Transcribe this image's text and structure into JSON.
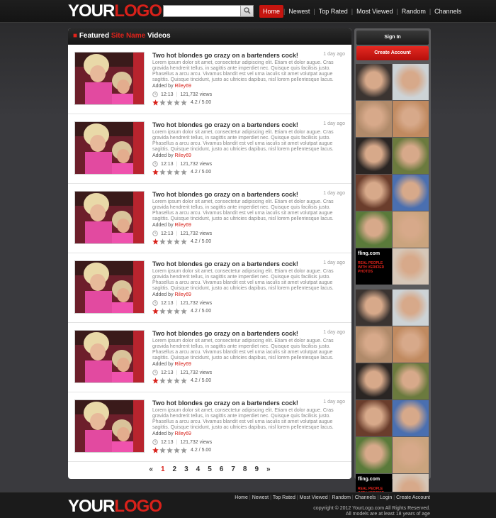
{
  "header": {
    "logo_part1": "YOUR",
    "logo_part2": "LOGO",
    "search_placeholder": "",
    "nav": [
      {
        "label": "Home",
        "active": true
      },
      {
        "label": "Newest"
      },
      {
        "label": "Top Rated"
      },
      {
        "label": "Most Viewed"
      },
      {
        "label": "Random"
      },
      {
        "label": "Channels"
      }
    ]
  },
  "content": {
    "heading_prefix": "Featured",
    "heading_highlight": "Site Name",
    "heading_suffix": "Videos",
    "videos": [
      {
        "title": "Two hot blondes go crazy on a bartenders cock!",
        "ago": "1 day ago",
        "description": "Lorem ipsum dolor sit amet, consectetur adipiscing elit. Etiam et dolor augue. Cras gravida hendrerit tellus, in sagittis ante imperdiet nec. Quisque quis facilisis justo. Phasellus a arcu arcu. Vivamus blandit est vel urna iaculis sit amet volutpat augue sagittis. Quisque tincidunt, justo ac ultricies dapibus, nisl lorem pellentesque lacus.",
        "added_by_label": "Added by",
        "user": "Riley69",
        "duration": "12:13",
        "views": "121,732 views",
        "rating": "4.2 / 5.00"
      },
      {
        "title": "Two hot blondes go crazy on a bartenders cock!",
        "ago": "1 day ago",
        "description": "Lorem ipsum dolor sit amet, consectetur adipiscing elit. Etiam et dolor augue. Cras gravida hendrerit tellus, in sagittis ante imperdiet nec. Quisque quis facilisis justo. Phasellus a arcu arcu. Vivamus blandit est vel urna iaculis sit amet volutpat augue sagittis. Quisque tincidunt, justo ac ultricies dapibus, nisl lorem pellentesque lacus.",
        "added_by_label": "Added by",
        "user": "Riley69",
        "duration": "12:13",
        "views": "121,732 views",
        "rating": "4.2 / 5.00"
      },
      {
        "title": "Two hot blondes go crazy on a bartenders cock!",
        "ago": "1 day ago",
        "description": "Lorem ipsum dolor sit amet, consectetur adipiscing elit. Etiam et dolor augue. Cras gravida hendrerit tellus, in sagittis ante imperdiet nec. Quisque quis facilisis justo. Phasellus a arcu arcu. Vivamus blandit est vel urna iaculis sit amet volutpat augue sagittis. Quisque tincidunt, justo ac ultricies dapibus, nisl lorem pellentesque lacus.",
        "added_by_label": "Added by",
        "user": "Riley69",
        "duration": "12:13",
        "views": "121,732 views",
        "rating": "4.2 / 5.00"
      },
      {
        "title": "Two hot blondes go crazy on a bartenders cock!",
        "ago": "1 day ago",
        "description": "Lorem ipsum dolor sit amet, consectetur adipiscing elit. Etiam et dolor augue. Cras gravida hendrerit tellus, in sagittis ante imperdiet nec. Quisque quis facilisis justo. Phasellus a arcu arcu. Vivamus blandit est vel urna iaculis sit amet volutpat augue sagittis. Quisque tincidunt, justo ac ultricies dapibus, nisl lorem pellentesque lacus.",
        "added_by_label": "Added by",
        "user": "Riley69",
        "duration": "12:13",
        "views": "121,732 views",
        "rating": "4.2 / 5.00"
      },
      {
        "title": "Two hot blondes go crazy on a bartenders cock!",
        "ago": "1 day ago",
        "description": "Lorem ipsum dolor sit amet, consectetur adipiscing elit. Etiam et dolor augue. Cras gravida hendrerit tellus, in sagittis ante imperdiet nec. Quisque quis facilisis justo. Phasellus a arcu arcu. Vivamus blandit est vel urna iaculis sit amet volutpat augue sagittis. Quisque tincidunt, justo ac ultricies dapibus, nisl lorem pellentesque lacus.",
        "added_by_label": "Added by",
        "user": "Riley69",
        "duration": "12:13",
        "views": "121,732 views",
        "rating": "4.2 / 5.00"
      },
      {
        "title": "Two hot blondes go crazy on a bartenders cock!",
        "ago": "1 day ago",
        "description": "Lorem ipsum dolor sit amet, consectetur adipiscing elit. Etiam et dolor augue. Cras gravida hendrerit tellus, in sagittis ante imperdiet nec. Quisque quis facilisis justo. Phasellus a arcu arcu. Vivamus blandit est vel urna iaculis sit amet volutpat augue sagittis. Quisque tincidunt, justo ac ultricies dapibus, nisl lorem pellentesque lacus.",
        "added_by_label": "Added by",
        "user": "Riley69",
        "duration": "12:13",
        "views": "121,732 views",
        "rating": "4.2 / 5.00"
      }
    ],
    "stars_filled": 1,
    "stars_total": 5
  },
  "pager": [
    "«",
    "1",
    "2",
    "3",
    "4",
    "5",
    "6",
    "7",
    "8",
    "9",
    "»"
  ],
  "pager_active": "1",
  "sidebar": {
    "signin": "Sign In",
    "create": "Create Account",
    "ad_brand": "fling.com",
    "ad_tagline": "REAL PEOPLE WITH VERIFIED PHOTOS"
  },
  "footer": {
    "nav": [
      "Home",
      "Newest",
      "Top Rated",
      "Most Viewed",
      "Random",
      "Channels",
      "Login",
      "Create Account"
    ],
    "copyright": "copyright © 2012 YourLogo.com All Rights Reserved.",
    "age_notice": "All models are at least 18 years of age"
  },
  "colors": {
    "accent": "#d8211a",
    "header_bg": "#1b1b1b",
    "page_bg": "#3a3a3e"
  }
}
